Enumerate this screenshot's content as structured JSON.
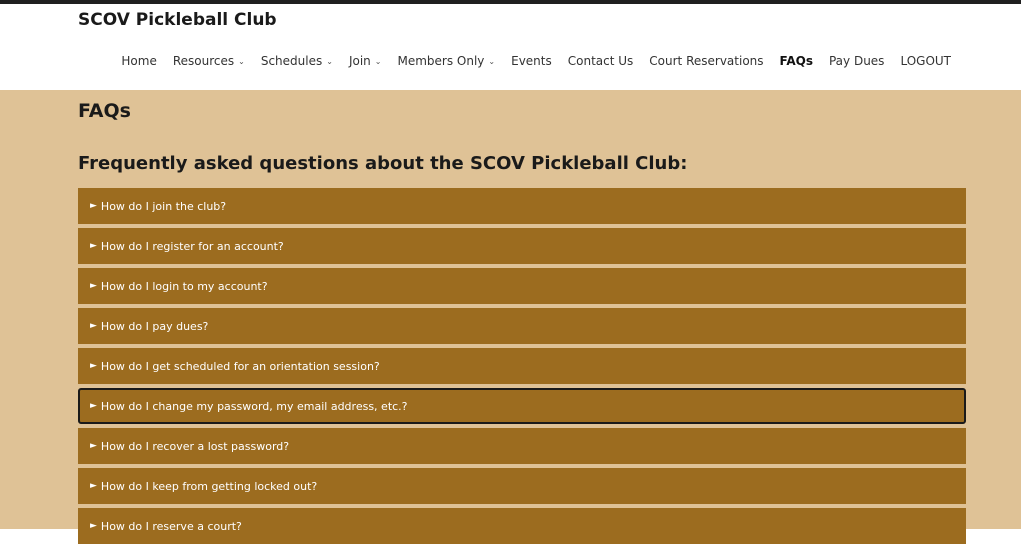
{
  "site": {
    "title": "SCOV Pickleball Club"
  },
  "nav": {
    "items": [
      {
        "label": "Home",
        "dropdown": false,
        "active": false
      },
      {
        "label": "Resources",
        "dropdown": true,
        "active": false
      },
      {
        "label": "Schedules",
        "dropdown": true,
        "active": false
      },
      {
        "label": "Join",
        "dropdown": true,
        "active": false
      },
      {
        "label": "Members Only",
        "dropdown": true,
        "active": false
      },
      {
        "label": "Events",
        "dropdown": false,
        "active": false
      },
      {
        "label": "Contact Us",
        "dropdown": false,
        "active": false
      },
      {
        "label": "Court Reservations",
        "dropdown": false,
        "active": false
      },
      {
        "label": "FAQs",
        "dropdown": false,
        "active": true
      },
      {
        "label": "Pay Dues",
        "dropdown": false,
        "active": false
      },
      {
        "label": "LOGOUT",
        "dropdown": false,
        "active": false
      }
    ],
    "caret_glyph": "⌄"
  },
  "main": {
    "page_title": "FAQs",
    "subheading": "Frequently asked questions about the SCOV Pickleball Club:",
    "marker_glyph": "►",
    "faqs": [
      {
        "question": "How do I join the club?",
        "focused": false
      },
      {
        "question": "How do I register for an account?",
        "focused": false
      },
      {
        "question": "How do I login to my account?",
        "focused": false
      },
      {
        "question": "How do I pay dues?",
        "focused": false
      },
      {
        "question": "How do I get scheduled for an orientation session?",
        "focused": false
      },
      {
        "question": "How do I change my password, my email address, etc.?",
        "focused": true
      },
      {
        "question": "How do I recover a lost password?",
        "focused": false
      },
      {
        "question": "How do I keep from getting locked out?",
        "focused": false
      },
      {
        "question": "How do I reserve a court?",
        "focused": false
      }
    ]
  },
  "colors": {
    "page_background": "#dfc296",
    "faq_background": "#9c6c1f",
    "faq_text": "#ffffff",
    "header_background": "#ffffff"
  }
}
